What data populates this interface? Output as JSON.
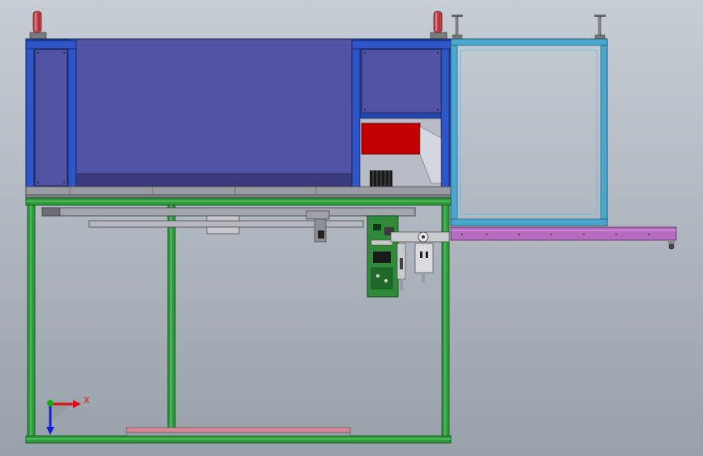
{
  "view": {
    "background_top": "#c5cbd3",
    "background_bottom": "#979fa9"
  },
  "triad": {
    "x_label": "X",
    "x_color": "#e0101a",
    "y_color": "#1020d0",
    "z_color": "#10b010"
  },
  "colors": {
    "upper_frame": "#1f46b4",
    "upper_panel": "#5252a6",
    "side_frame": "#4aa3c8",
    "lower_frame": "#2d9a3c",
    "conveyor": "#b56cc0",
    "pcb": "#2f8a3a",
    "red_block": "#c00000",
    "plate": "#8e9199",
    "pink_strip": "#d68a9a"
  },
  "parts": [
    "caster-wheel",
    "upper-blue-frame",
    "main-cover-panel",
    "left-cover-panel",
    "right-cover-panel",
    "red-block",
    "black-gear",
    "side-light-blue-frame",
    "lower-green-frame",
    "purple-conveyor",
    "circuit-board",
    "linear-guide-rail",
    "base-pink-strip"
  ]
}
